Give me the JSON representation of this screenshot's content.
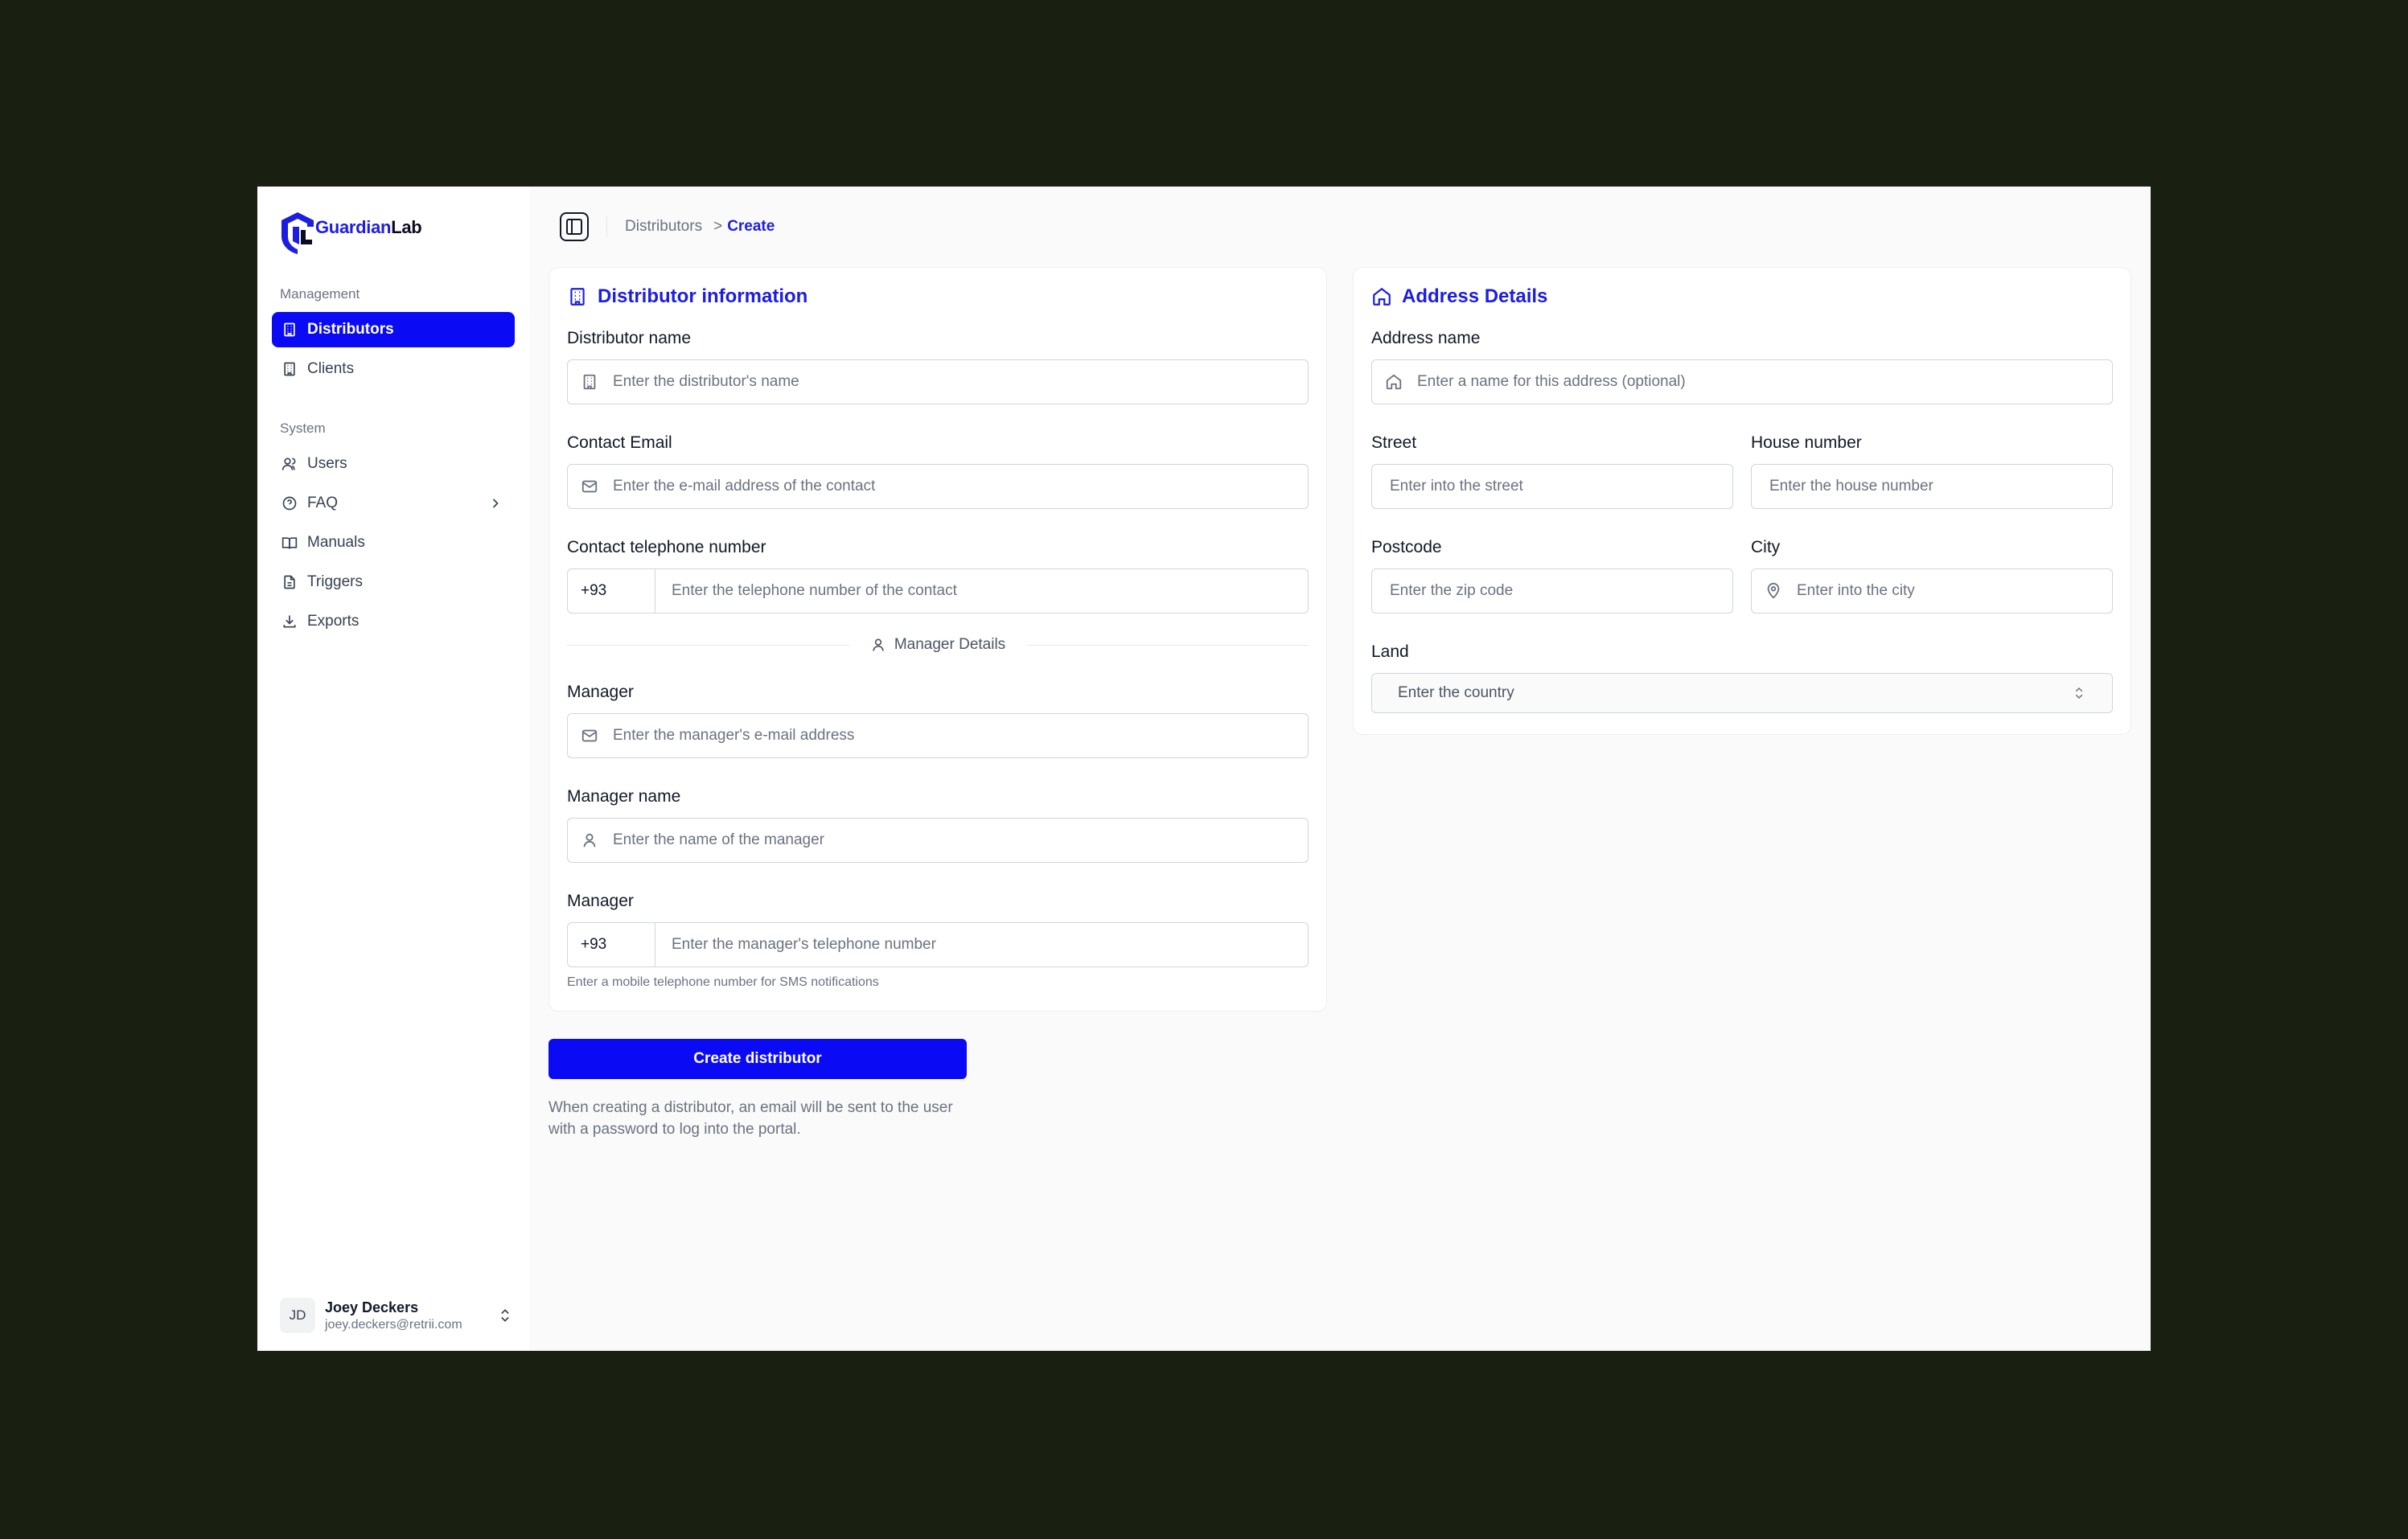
{
  "app": {
    "logo_primary": "Guardian",
    "logo_secondary": "Lab"
  },
  "sidebar": {
    "management_label": "Management",
    "system_label": "System",
    "items": [
      {
        "label": "Distributors",
        "icon": "building-icon"
      },
      {
        "label": "Clients",
        "icon": "building-icon"
      },
      {
        "label": "Users",
        "icon": "users-icon"
      },
      {
        "label": "FAQ",
        "icon": "help-circle-icon"
      },
      {
        "label": "Manuals",
        "icon": "book-icon"
      },
      {
        "label": "Triggers",
        "icon": "file-icon"
      },
      {
        "label": "Exports",
        "icon": "download-icon"
      }
    ],
    "user": {
      "initials": "JD",
      "name": "Joey Deckers",
      "email": "joey.deckers@retrii.com"
    }
  },
  "breadcrumb": {
    "parent": "Distributors",
    "separator": ">",
    "current": "Create"
  },
  "distributor_card": {
    "title": "Distributor information",
    "name_label": "Distributor name",
    "name_placeholder": "Enter the distributor's name",
    "email_label": "Contact Email",
    "email_placeholder": "Enter the e-mail address of the contact",
    "phone_label": "Contact telephone number",
    "phone_code": "+93",
    "phone_placeholder": "Enter the telephone number of the contact",
    "manager_divider": "Manager Details",
    "manager_email_label": "Manager",
    "manager_email_placeholder": "Enter the manager's e-mail address",
    "manager_name_label": "Manager name",
    "manager_name_placeholder": "Enter the name of the manager",
    "manager_phone_label": "Manager",
    "manager_phone_code": "+93",
    "manager_phone_placeholder": "Enter the manager's telephone number",
    "manager_phone_hint": "Enter a mobile telephone number for SMS notifications"
  },
  "address_card": {
    "title": "Address Details",
    "address_name_label": "Address name",
    "address_name_placeholder": "Enter a name for this address (optional)",
    "street_label": "Street",
    "street_placeholder": "Enter into the street",
    "house_label": "House number",
    "house_placeholder": "Enter the house number",
    "postcode_label": "Postcode",
    "postcode_placeholder": "Enter the zip code",
    "city_label": "City",
    "city_placeholder": "Enter into the city",
    "land_label": "Land",
    "land_placeholder": "Enter the country"
  },
  "actions": {
    "create_label": "Create distributor",
    "note": "When creating a distributor, an email will be sent to the user with a password to log into the portal."
  },
  "colors": {
    "accent": "#0a0af5",
    "title_blue": "#1d1de0",
    "backdrop": "#1a2011"
  }
}
